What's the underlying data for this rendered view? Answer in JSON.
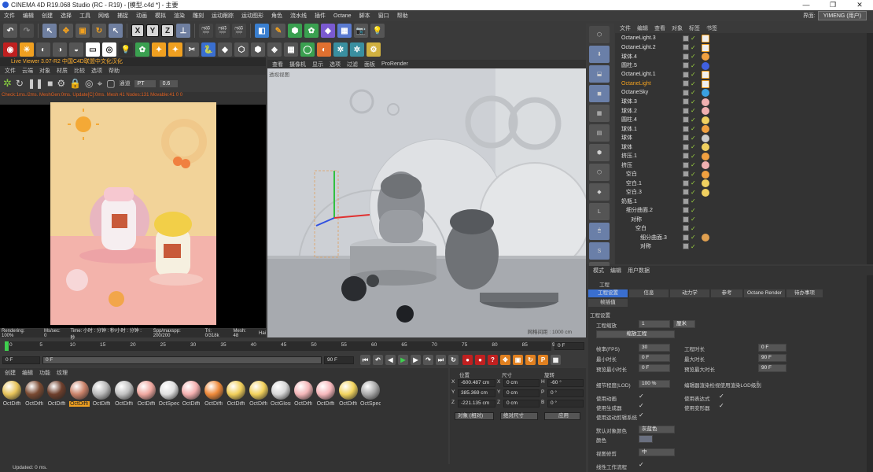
{
  "window": {
    "title": "CINEMA 4D R19.068 Studio (RC - R19) - [模型.c4d *] - 主要",
    "controls": [
      "—",
      "❐",
      "✕"
    ]
  },
  "menu": {
    "items": [
      "文件",
      "编辑",
      "创建",
      "选择",
      "工具",
      "网格",
      "捕捉",
      "动画",
      "模拟",
      "渲染",
      "雕刻",
      "运动跟踪",
      "运动图形",
      "角色",
      "流水线",
      "插件",
      "Octane",
      "脚本",
      "窗口",
      "帮助"
    ],
    "interface_label": "界面:",
    "interface_value": "YIMENG (用户)"
  },
  "live_viewer": {
    "title": "Live Viewer 3.07-R2 中国C4D联盟中文化汉化",
    "menu": [
      "文件",
      "云端",
      "对象",
      "材质",
      "比较",
      "选项",
      "帮助"
    ],
    "render_mode": "PT",
    "render_value": "0.6",
    "mode_label": "通道",
    "status": "Check:1ms./2ms. MeshGen:0ms. Update[C]:0ms. Mesh:41 Nodes:131 Movable:41 0 0",
    "footer": [
      "Rendering: 100%",
      "Ms/sec: 0",
      "Time: 小时 : 分钟 : 秒/小时 : 分钟 : 秒",
      "Spp/maxspp: 200/200",
      "Tri: 0/318k",
      "Mesh: 48",
      "Hai"
    ]
  },
  "viewport": {
    "menu": [
      "查看",
      "摄像机",
      "显示",
      "选项",
      "过滤",
      "面板",
      "ProRender"
    ],
    "label": "透视视图",
    "grid_info": "网格间距 : 1000 cm"
  },
  "object_manager": {
    "menu": [
      "文件",
      "编辑",
      "查看",
      "对象",
      "标签",
      "书签"
    ],
    "objects": [
      {
        "name": "OctaneLight.3",
        "indent": 0,
        "tag": "light"
      },
      {
        "name": "OctaneLight.2",
        "indent": 0,
        "tag": "light"
      },
      {
        "name": "球体.4",
        "indent": 0,
        "tag": "mat-orange"
      },
      {
        "name": "圆柱.5",
        "indent": 0,
        "tag": "mat-blue"
      },
      {
        "name": "OctaneLight.1",
        "indent": 0,
        "tag": "light"
      },
      {
        "name": "OctaneLight",
        "indent": 0,
        "tag": "light",
        "highlight": true
      },
      {
        "name": "OctaneSky",
        "indent": 0,
        "tag": "sky"
      },
      {
        "name": "球体.3",
        "indent": 0,
        "tag": "mat-pink"
      },
      {
        "name": "球体.2",
        "indent": 0,
        "tag": "mat-pink"
      },
      {
        "name": "圆柱.4",
        "indent": 0,
        "tag": "mat-yellow"
      },
      {
        "name": "球体.1",
        "indent": 0,
        "tag": "mat-orange"
      },
      {
        "name": "球体",
        "indent": 0,
        "tag": "mat-check"
      },
      {
        "name": "球体",
        "indent": 0,
        "tag": "mat-yellow"
      },
      {
        "name": "挤压.1",
        "indent": 0,
        "tag": "mat-orange"
      },
      {
        "name": "挤压",
        "indent": 0,
        "tag": "mat-pink"
      },
      {
        "name": "空白",
        "indent": 1,
        "tag": "mat-orange"
      },
      {
        "name": "空白.1",
        "indent": 1,
        "tag": "mat-yellow"
      },
      {
        "name": "空白.3",
        "indent": 1,
        "tag": "mat-yellow"
      },
      {
        "name": "奶瓶.1",
        "indent": 0,
        "tag": ""
      },
      {
        "name": "细分曲面.2",
        "indent": 1,
        "tag": ""
      },
      {
        "name": "对称",
        "indent": 2,
        "tag": ""
      },
      {
        "name": "空白",
        "indent": 3,
        "tag": ""
      },
      {
        "name": "细分曲面.3",
        "indent": 4,
        "tag": "mat-multi"
      },
      {
        "name": "对称",
        "indent": 4,
        "tag": ""
      }
    ]
  },
  "timeline": {
    "ticks": [
      "0",
      "5",
      "10",
      "15",
      "20",
      "25",
      "30",
      "35",
      "40",
      "45",
      "50",
      "55",
      "60",
      "65",
      "70",
      "75",
      "80",
      "85",
      "90"
    ],
    "current": "0 F",
    "start": "0 F",
    "field2": "0 F",
    "end": "90 F",
    "end2": "90 F"
  },
  "material_manager": {
    "menu": [
      "创建",
      "编辑",
      "功能",
      "纹理"
    ],
    "materials": [
      {
        "label": "OctDiffi",
        "color": "#e8c45a"
      },
      {
        "label": "OctDiffi",
        "color": "#7a4a32"
      },
      {
        "label": "OctDiffi",
        "color": "#6e3f2c"
      },
      {
        "label": "OctDiffi",
        "color": "#c9826a",
        "selected": true
      },
      {
        "label": "OctDiffi",
        "color": "#b9b9b9"
      },
      {
        "label": "OctDiffi",
        "color": "#c2c2c2"
      },
      {
        "label": "OctDiffi",
        "color": "#f0a8a0"
      },
      {
        "label": "OctSpec",
        "color": "#e0e0e0"
      },
      {
        "label": "OctDiffi",
        "color": "#f5b0b0"
      },
      {
        "label": "OctDiffi",
        "color": "#ef8a3a"
      },
      {
        "label": "OctDiffi",
        "color": "#f1cf5a"
      },
      {
        "label": "OctDiffi",
        "color": "#f3d25c"
      },
      {
        "label": "OctGloss",
        "color": "#d8d8d8"
      },
      {
        "label": "OctDiffi",
        "color": "#f4b6b8"
      },
      {
        "label": "OctDiffi",
        "color": "#f7b8bc"
      },
      {
        "label": "OctDiffi",
        "color": "#f2d45e"
      },
      {
        "label": "OctSpec",
        "color": "#aaaaaa"
      }
    ]
  },
  "coordinates": {
    "headers": [
      "位置",
      "尺寸",
      "旋转"
    ],
    "rows": [
      {
        "axis": "X",
        "pos": "-600.487 cm",
        "size": "0 cm",
        "rl": "H",
        "rot": "-60 °"
      },
      {
        "axis": "Y",
        "pos": "385.369 cm",
        "size": "0 cm",
        "rl": "P",
        "rot": "0 °"
      },
      {
        "axis": "Z",
        "pos": "-221.135 cm",
        "size": "0 cm",
        "rl": "B",
        "rot": "0 °"
      }
    ],
    "mode1": "对象 (相对)",
    "mode2": "绝对尺寸",
    "apply": "应用"
  },
  "attributes": {
    "menu": [
      "模式",
      "编辑",
      "用户数据"
    ],
    "section": "工程",
    "tabs": [
      "工程设置",
      "信息",
      "动力学",
      "参考",
      "Octane Render",
      "待办事项",
      "帧插值"
    ],
    "group_title": "工程设置",
    "scale_label": "工程缩放",
    "scale_value": "1",
    "scale_unit": "厘米",
    "scale_btn": "缩放工程",
    "fps_label": "帧率(FPS)",
    "fps_value": "30",
    "proj_len_label": "工程时长",
    "proj_len_value": "0 F",
    "min_label": "最小时长",
    "min_value": "0 F",
    "max_label": "最大时长",
    "max_value": "90 F",
    "pmin_label": "预览最小时长",
    "pmin_value": "0 F",
    "pmax_label": "预览最大时长",
    "pmax_value": "90 F",
    "lod_label": "细节程度(LOD)",
    "lod_value": "100 %",
    "lod_render_label": "编辑器渲染检视使用渲染LOD级别",
    "anim_label": "使用动画",
    "expr_label": "使用表达式",
    "gen_label": "使用生成器",
    "deform_label": "使用变形器",
    "motion_label": "使用运动剪辑系统",
    "objcolor_label": "默认对象颜色",
    "objcolor_value": "灰蓝色",
    "color_label": "颜色",
    "clip_label": "视图修剪",
    "clip_value": "中",
    "linear_label": "线性工作流程"
  },
  "status": {
    "text": "Updated: 0 ms."
  }
}
